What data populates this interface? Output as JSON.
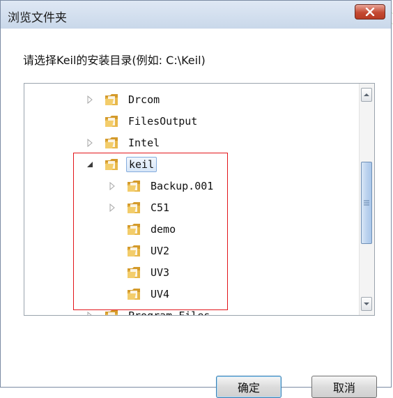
{
  "window": {
    "title": "浏览文件夹",
    "close_icon": "close-x-icon"
  },
  "prompt": "请选择Keil的安装目录(例如: C:\\Keil)",
  "tree": {
    "items": [
      {
        "label": "Drcom",
        "expander": "collapsed",
        "level": 1
      },
      {
        "label": "FilesOutput",
        "expander": "none",
        "level": 1
      },
      {
        "label": "Intel",
        "expander": "collapsed",
        "level": 1
      },
      {
        "label": "keil",
        "expander": "expanded",
        "level": 1,
        "selected": true
      },
      {
        "label": "Backup.001",
        "expander": "collapsed",
        "level": 2
      },
      {
        "label": "C51",
        "expander": "collapsed",
        "level": 2
      },
      {
        "label": "demo",
        "expander": "none",
        "level": 2
      },
      {
        "label": "UV2",
        "expander": "none",
        "level": 2
      },
      {
        "label": "UV3",
        "expander": "none",
        "level": 2
      },
      {
        "label": "UV4",
        "expander": "none",
        "level": 2
      },
      {
        "label": "Program Files",
        "expander": "collapsed",
        "level": 1,
        "partial": true
      }
    ]
  },
  "buttons": {
    "ok": "确定",
    "cancel": "取消"
  },
  "colors": {
    "highlight_box": "#e2141a",
    "close_button": "#c44a33",
    "folder": "#e8b84a"
  }
}
